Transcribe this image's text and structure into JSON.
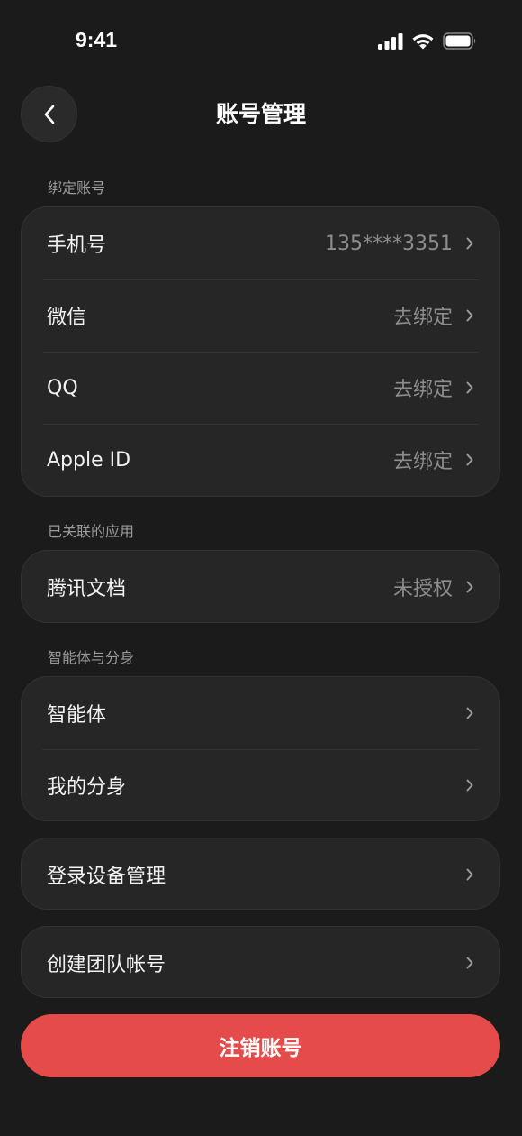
{
  "status_bar": {
    "time": "9:41"
  },
  "nav": {
    "title": "账号管理"
  },
  "sections": {
    "bound": {
      "label": "绑定账号",
      "items": [
        {
          "label": "手机号",
          "value": "135****3351"
        },
        {
          "label": "微信",
          "value": "去绑定"
        },
        {
          "label": "QQ",
          "value": "去绑定"
        },
        {
          "label": "Apple ID",
          "value": "去绑定"
        }
      ]
    },
    "apps": {
      "label": "已关联的应用",
      "items": [
        {
          "label": "腾讯文档",
          "value": "未授权"
        }
      ]
    },
    "agents": {
      "label": "智能体与分身",
      "items": [
        {
          "label": "智能体"
        },
        {
          "label": "我的分身"
        }
      ]
    },
    "devices": {
      "label": "登录设备管理"
    },
    "team": {
      "label": "创建团队帐号"
    }
  },
  "danger": {
    "label": "注销账号"
  },
  "colors": {
    "background": "#1b1b1b",
    "card": "#262626",
    "danger": "#e54b4b"
  }
}
